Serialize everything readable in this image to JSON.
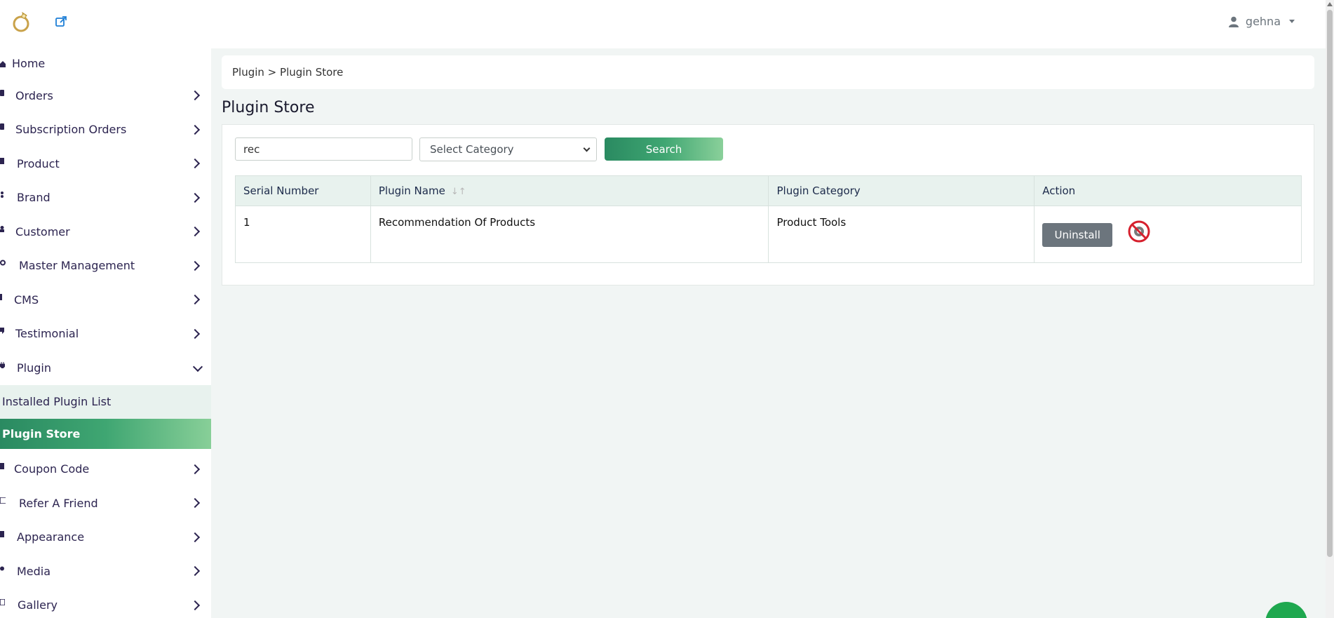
{
  "header": {
    "user_name": "gehna"
  },
  "sidebar": {
    "items": [
      {
        "label": "Home"
      },
      {
        "label": "Orders"
      },
      {
        "label": "Subscription Orders"
      },
      {
        "label": "Product"
      },
      {
        "label": "Brand"
      },
      {
        "label": "Customer"
      },
      {
        "label": "Master Management"
      },
      {
        "label": "CMS"
      },
      {
        "label": "Testimonial"
      },
      {
        "label": "Plugin"
      },
      {
        "label": "Coupon Code"
      },
      {
        "label": "Refer A Friend"
      },
      {
        "label": "Appearance"
      },
      {
        "label": "Media"
      },
      {
        "label": "Gallery"
      }
    ],
    "plugin_sub": [
      {
        "label": "Installed Plugin List"
      },
      {
        "label": "Plugin Store"
      }
    ]
  },
  "main": {
    "breadcrumb": "Plugin > Plugin Store",
    "title": "Plugin Store",
    "search": {
      "value": "rec",
      "category_placeholder": "Select Category",
      "button_label": "Search"
    },
    "table": {
      "headers": [
        "Serial Number",
        "Plugin Name",
        "Plugin Category",
        "Action"
      ],
      "rows": [
        {
          "serial": "1",
          "name": "Recommendation Of Products",
          "category": "Product Tools",
          "action_label": "Uninstall"
        }
      ]
    }
  },
  "colors": {
    "accent_green": "#2a8a61",
    "accent_green_light": "#88cf98",
    "button_gray": "#6c757d",
    "disable_red": "#d6202d"
  }
}
